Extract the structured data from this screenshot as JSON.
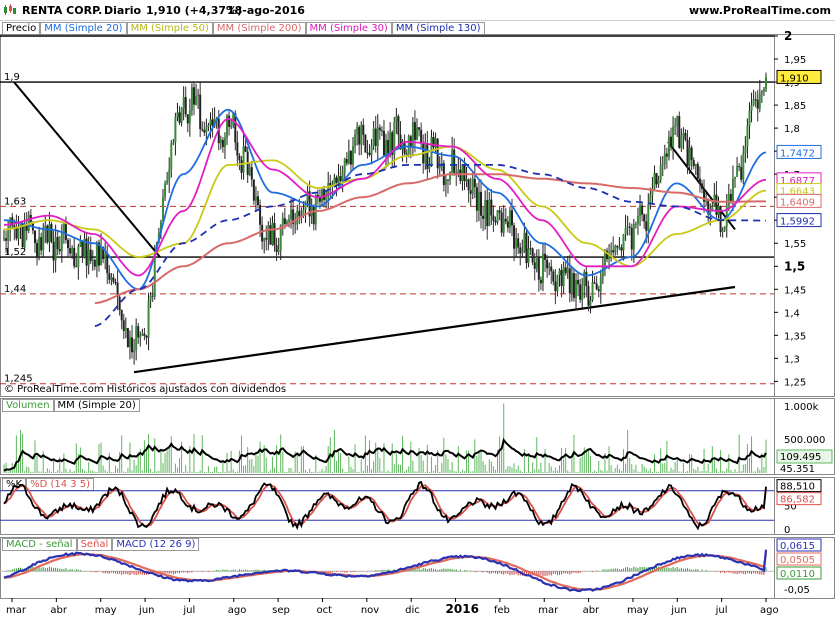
{
  "header": {
    "ticker": "RENTA CORP.",
    "period": "Diario",
    "quote": "1,910 (+4,37%)",
    "date": "18-ago-2016",
    "site": "www.ProRealTime.com"
  },
  "legend_price": [
    "Precio",
    "MM (Simple 20)",
    "MM (Simple 50)",
    "MM (Simple 200)",
    "MM (Simple 30)",
    "MM (Simple 130)"
  ],
  "legend_volume": [
    "Volumen",
    "MM (Simple 20)"
  ],
  "legend_stoch": [
    "%K",
    "%D (14 3 5)"
  ],
  "legend_macd": [
    "MACD - señal",
    "Señal",
    "MACD (12 26 9)"
  ],
  "colors": {
    "price": "#000000",
    "ma20": "#1f6ee0",
    "ma50": "#c9c917",
    "ma200": "#d86a6a",
    "ma30": "#e11ec4",
    "ma130": "#1f2fb0",
    "volume": "#5cb85c",
    "stoch_k": "#000000",
    "stoch_d": "#d9534f",
    "macd": "#2b32b2",
    "signal": "#e06b5a",
    "hist_pos": "#3a9a3a",
    "hist_neg": "#c94040"
  },
  "footnote": "© ProRealTime.com Históricos ajustados con dividendos",
  "chart_data": [
    {
      "type": "line",
      "panel": "price",
      "x": [
        "mar",
        "abr",
        "may",
        "jun",
        "jul",
        "ago",
        "sep",
        "oct",
        "nov",
        "dic",
        "2016",
        "feb",
        "mar",
        "abr",
        "may",
        "jun",
        "jul",
        "ago"
      ],
      "series": [
        {
          "name": "Precio",
          "values": [
            1.58,
            1.56,
            1.52,
            1.34,
            1.85,
            1.8,
            1.56,
            1.64,
            1.77,
            1.78,
            1.72,
            1.6,
            1.5,
            1.45,
            1.57,
            1.78,
            1.6,
            1.91
          ]
        },
        {
          "name": "MM (Simple 20)",
          "values": [
            1.6,
            1.58,
            1.55,
            1.45,
            1.7,
            1.84,
            1.66,
            1.63,
            1.72,
            1.76,
            1.74,
            1.66,
            1.55,
            1.48,
            1.52,
            1.68,
            1.6,
            1.7472
          ]
        },
        {
          "name": "MM (Simple 50)",
          "values": [
            1.58,
            1.6,
            1.58,
            1.52,
            1.55,
            1.72,
            1.73,
            1.67,
            1.69,
            1.74,
            1.76,
            1.71,
            1.63,
            1.55,
            1.5,
            1.57,
            1.6,
            1.6643
          ]
        },
        {
          "name": "MM (Simple 200)",
          "values": [
            null,
            null,
            1.42,
            1.45,
            1.5,
            1.55,
            1.58,
            1.62,
            1.65,
            1.68,
            1.7,
            1.7,
            1.69,
            1.68,
            1.67,
            1.66,
            1.64,
            1.6409
          ]
        },
        {
          "name": "MM (Simple 30)",
          "values": [
            1.59,
            1.61,
            1.57,
            1.48,
            1.62,
            1.82,
            1.71,
            1.65,
            1.69,
            1.77,
            1.76,
            1.69,
            1.6,
            1.5,
            1.5,
            1.63,
            1.62,
            1.6877
          ]
        },
        {
          "name": "MM (Simple 130)",
          "values": [
            null,
            null,
            1.37,
            1.45,
            1.55,
            1.6,
            1.63,
            1.66,
            1.7,
            1.72,
            1.72,
            1.72,
            1.7,
            1.67,
            1.64,
            1.63,
            1.6,
            1.5992
          ]
        }
      ],
      "ylim": [
        1.24,
        2.0
      ],
      "y_ticks": [
        1.25,
        1.3,
        1.35,
        1.4,
        1.45,
        1.5,
        1.55,
        1.6,
        1.65,
        1.7,
        1.75,
        1.8,
        1.85,
        1.9,
        1.95,
        2
      ],
      "y_tick_labels": [
        "1,25",
        "1,3",
        "1,35",
        "1,4",
        "1,45",
        "1,5",
        "1,55",
        "1,6",
        "1,65",
        "1,7",
        "1,75",
        "1,8",
        "1,85",
        "1,9",
        "1,95",
        "2"
      ],
      "levels": [
        {
          "value": 2.0,
          "style": "solid",
          "label": ""
        },
        {
          "value": 1.9,
          "style": "solid",
          "label": "1,9"
        },
        {
          "value": 1.52,
          "style": "solid",
          "label": "1,52"
        },
        {
          "value": 1.63,
          "style": "dashed",
          "label": "1,63"
        },
        {
          "value": 1.44,
          "style": "dashed",
          "label": "1,44"
        },
        {
          "value": 1.245,
          "style": "dashed",
          "label": "1,245"
        }
      ],
      "last_values": [
        {
          "label": "1,910",
          "series": "Precio"
        },
        {
          "label": "1,7472",
          "series": "MM (Simple 20)"
        },
        {
          "label": "1,6877",
          "series": "MM (Simple 30)"
        },
        {
          "label": "1,6643",
          "series": "MM (Simple 50)"
        },
        {
          "label": "1,6409",
          "series": "MM (Simple 200)"
        },
        {
          "label": "1,5992",
          "series": "MM (Simple 130)"
        }
      ]
    },
    {
      "type": "bar",
      "panel": "volume",
      "y_tick_labels": [
        "1.000k",
        "500.000"
      ],
      "last_values": [
        {
          "label": "109.495"
        },
        {
          "label": "45.351"
        }
      ]
    },
    {
      "type": "line",
      "panel": "stochastic",
      "series": [
        {
          "name": "%K"
        },
        {
          "name": "%D (14 3 5)"
        }
      ],
      "y_tick_labels": [
        "50",
        "0"
      ],
      "last_values": [
        {
          "label": "88,510",
          "series": "%K"
        },
        {
          "label": "86,582",
          "series": "%D (14 3 5)"
        }
      ]
    },
    {
      "type": "line",
      "panel": "macd",
      "series": [
        {
          "name": "MACD (12 26 9)"
        },
        {
          "name": "Señal"
        },
        {
          "name": "MACD - señal"
        }
      ],
      "y_tick_labels": [
        "-0,05"
      ],
      "last_values": [
        {
          "label": "0,0615",
          "series": "MACD (12 26 9)"
        },
        {
          "label": "0,0505",
          "series": "Señal"
        },
        {
          "label": "0,0110",
          "series": "MACD - señal"
        }
      ]
    }
  ]
}
